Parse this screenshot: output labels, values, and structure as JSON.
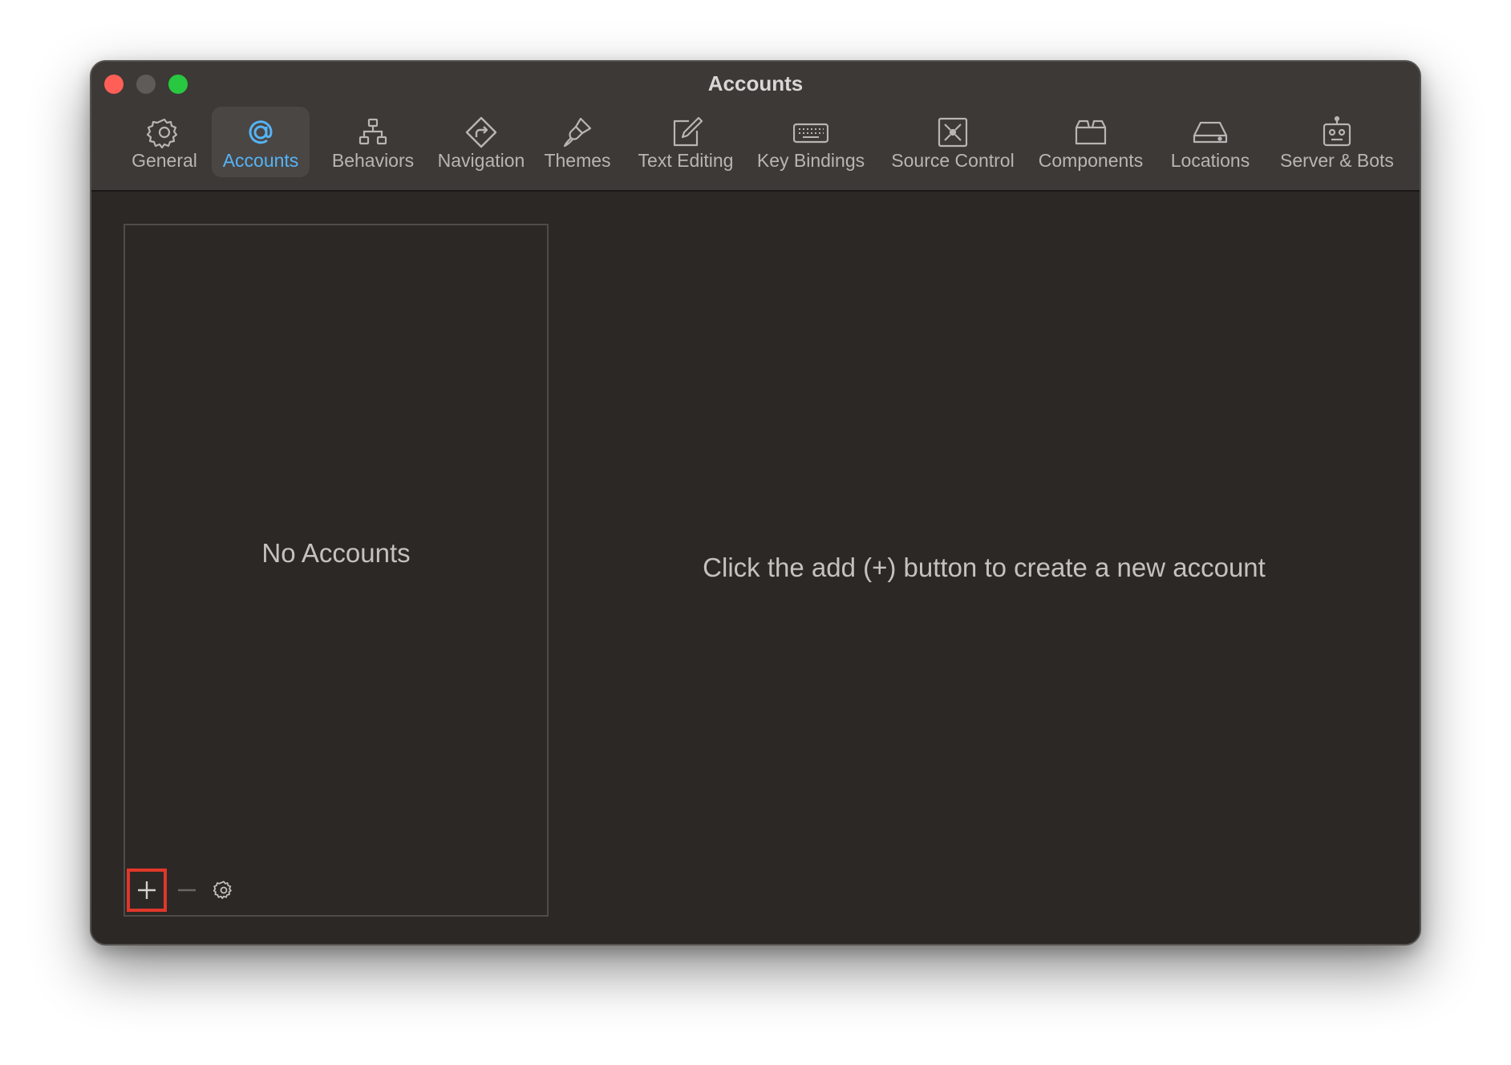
{
  "window": {
    "title": "Accounts"
  },
  "toolbar": {
    "tabs": [
      {
        "label": "General",
        "icon": "gear-icon"
      },
      {
        "label": "Accounts",
        "icon": "at-sign-icon",
        "selected": true
      },
      {
        "label": "Behaviors",
        "icon": "hierarchy-icon"
      },
      {
        "label": "Navigation",
        "icon": "navigation-arrow-icon"
      },
      {
        "label": "Themes",
        "icon": "paintbrush-icon"
      },
      {
        "label": "Text Editing",
        "icon": "pencil-square-icon"
      },
      {
        "label": "Key Bindings",
        "icon": "keyboard-icon"
      },
      {
        "label": "Source Control",
        "icon": "source-control-icon"
      },
      {
        "label": "Components",
        "icon": "box-icon"
      },
      {
        "label": "Locations",
        "icon": "drive-icon"
      },
      {
        "label": "Server & Bots",
        "icon": "robot-icon"
      }
    ]
  },
  "accounts_list": {
    "empty_text": "No Accounts",
    "add_label": "+",
    "remove_label": "—"
  },
  "detail": {
    "message": "Click the add (+) button to create a new account"
  },
  "colors": {
    "accent": "#55b4f6",
    "highlight": "#e0372b",
    "window_bg": "#2c2825",
    "titlebar_bg": "#3d3937"
  }
}
